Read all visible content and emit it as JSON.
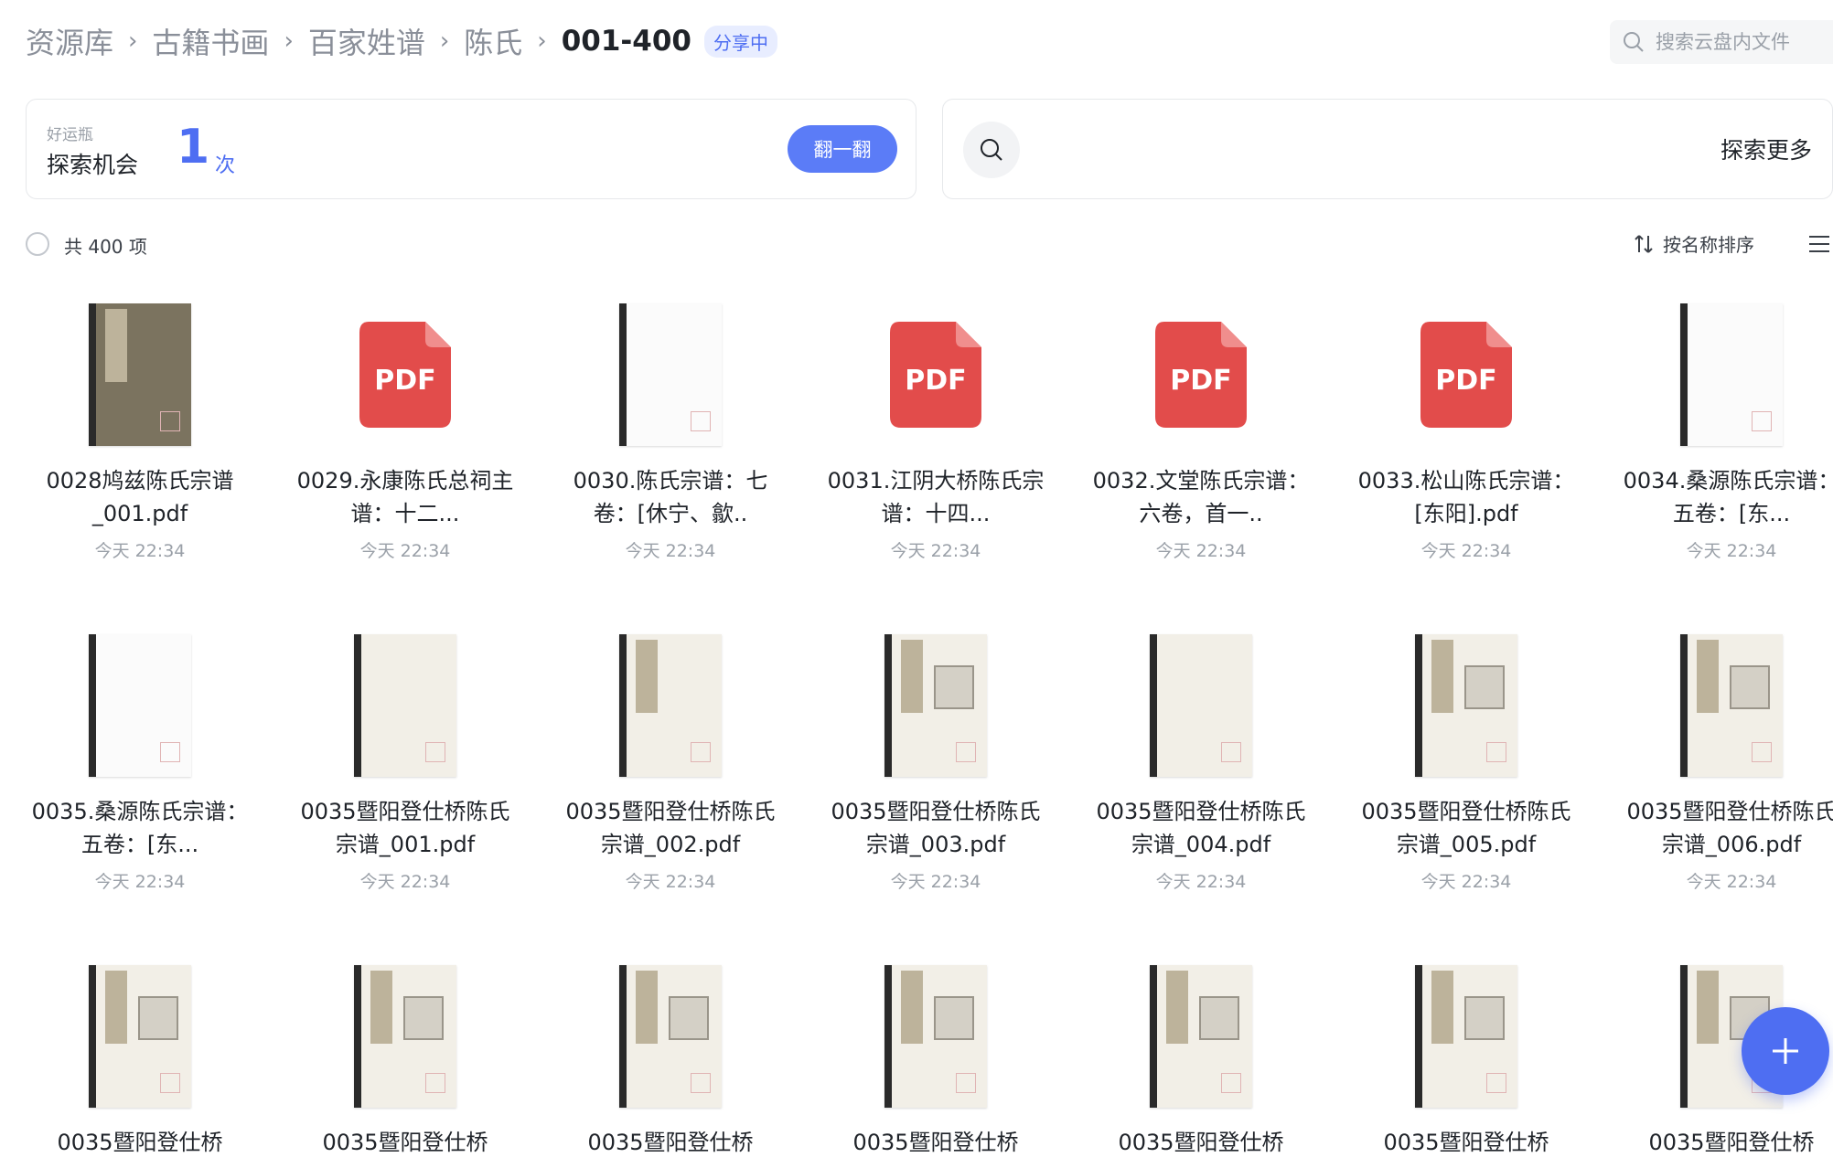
{
  "breadcrumb": {
    "items": [
      "资源库",
      "古籍书画",
      "百家姓谱",
      "陈氏"
    ],
    "separator": "›",
    "current": "001-400",
    "badge": "分享中"
  },
  "search": {
    "placeholder": "搜索云盘内文件"
  },
  "lucky": {
    "small_label": "好运瓶",
    "label": "探索机会",
    "count": "1",
    "unit": "次",
    "button": "翻一翻"
  },
  "explore": {
    "label": "探索更多"
  },
  "toolbar": {
    "total": "共 400 项",
    "sort_label": "按名称排序"
  },
  "colors": {
    "accent": "#4e6ef2",
    "pdf": "#e24c4b"
  },
  "files": [
    {
      "name": "0028鸠兹陈氏宗谱_001.pdf",
      "time": "今天 22:34",
      "thumb": "book-dark"
    },
    {
      "name": "0029.永康陈氏总祠主谱：十二...",
      "time": "今天 22:34",
      "thumb": "pdf"
    },
    {
      "name": "0030.陈氏宗谱：七卷：[休宁、歙..",
      "time": "今天 22:34",
      "thumb": "book-blank"
    },
    {
      "name": "0031.江阴大桥陈氏宗谱：十四...",
      "time": "今天 22:34",
      "thumb": "pdf"
    },
    {
      "name": "0032.文堂陈氏宗谱：六卷，首一..",
      "time": "今天 22:34",
      "thumb": "pdf"
    },
    {
      "name": "0033.松山陈氏宗谱：[东阳].pdf",
      "time": "今天 22:34",
      "thumb": "pdf"
    },
    {
      "name": "0034.桑源陈氏宗谱：五卷：[东...",
      "time": "今天 22:34",
      "thumb": "book-blank"
    },
    {
      "name": "0035.桑源陈氏宗谱：五卷：[东...",
      "time": "今天 22:34",
      "thumb": "book-blank"
    },
    {
      "name": "0035暨阳登仕桥陈氏宗谱_001.pdf",
      "time": "今天 22:34",
      "thumb": "book-paper"
    },
    {
      "name": "0035暨阳登仕桥陈氏宗谱_002.pdf",
      "time": "今天 22:34",
      "thumb": "book-strip"
    },
    {
      "name": "0035暨阳登仕桥陈氏宗谱_003.pdf",
      "time": "今天 22:34",
      "thumb": "book-plate"
    },
    {
      "name": "0035暨阳登仕桥陈氏宗谱_004.pdf",
      "time": "今天 22:34",
      "thumb": "book-paper"
    },
    {
      "name": "0035暨阳登仕桥陈氏宗谱_005.pdf",
      "time": "今天 22:34",
      "thumb": "book-plate"
    },
    {
      "name": "0035暨阳登仕桥陈氏宗谱_006.pdf",
      "time": "今天 22:34",
      "thumb": "book-plate"
    },
    {
      "name": "0035暨阳登仕桥",
      "time": "",
      "thumb": "book-plate"
    },
    {
      "name": "0035暨阳登仕桥",
      "time": "",
      "thumb": "book-plate"
    },
    {
      "name": "0035暨阳登仕桥",
      "time": "",
      "thumb": "book-plate"
    },
    {
      "name": "0035暨阳登仕桥",
      "time": "",
      "thumb": "book-plate"
    },
    {
      "name": "0035暨阳登仕桥",
      "time": "",
      "thumb": "book-plate"
    },
    {
      "name": "0035暨阳登仕桥",
      "time": "",
      "thumb": "book-plate"
    },
    {
      "name": "0035暨阳登仕桥",
      "time": "",
      "thumb": "book-plate"
    }
  ],
  "pdf_label": "PDF"
}
